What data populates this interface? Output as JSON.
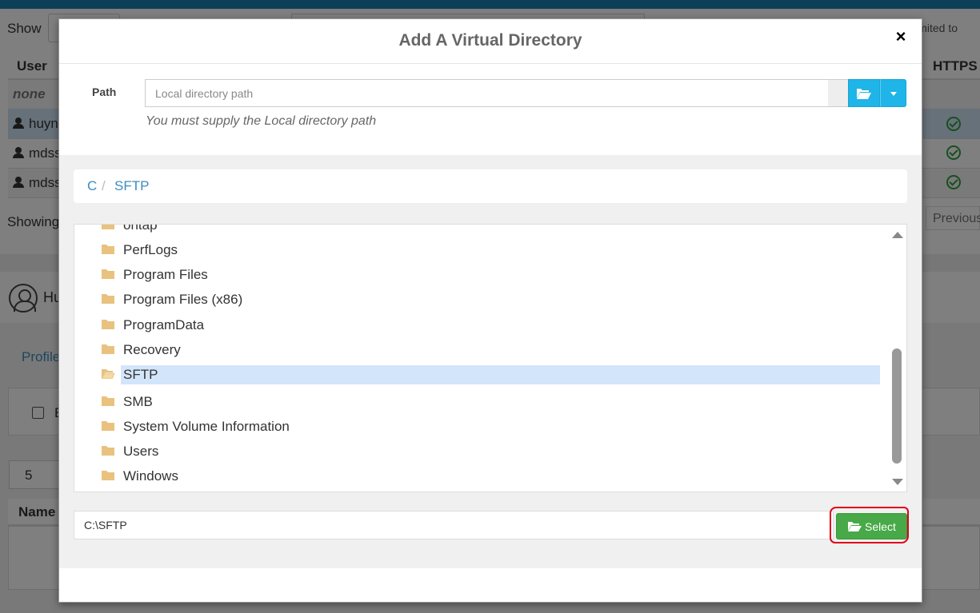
{
  "background": {
    "show_label": "Show",
    "filter_note": "er (limited to",
    "table": {
      "headers": {
        "user": "User",
        "https": "HTTPS"
      },
      "rows": [
        {
          "user": "none"
        },
        {
          "user": "huyn"
        },
        {
          "user": "mdss"
        },
        {
          "user": "mdss"
        }
      ]
    },
    "showing_text": "Showing",
    "previous_label": "Previous",
    "profile_heading": "Hu",
    "profile_tab": "Profile",
    "checkbox_label": "E",
    "page_size_value": "5",
    "name_header": "Name"
  },
  "modal": {
    "title": "Add A Virtual Directory",
    "close_glyph": "×",
    "path": {
      "label": "Path",
      "placeholder": "Local directory path",
      "value": "",
      "help_text": "You must supply the Local directory path"
    },
    "breadcrumb": [
      {
        "label": "C"
      },
      {
        "label": "SFTP"
      }
    ],
    "breadcrumb_separator": "/",
    "folders": [
      {
        "name": "ontap",
        "open": false,
        "selected": false
      },
      {
        "name": "PerfLogs",
        "open": false,
        "selected": false
      },
      {
        "name": "Program Files",
        "open": false,
        "selected": false
      },
      {
        "name": "Program Files (x86)",
        "open": false,
        "selected": false
      },
      {
        "name": "ProgramData",
        "open": false,
        "selected": false
      },
      {
        "name": "Recovery",
        "open": false,
        "selected": false
      },
      {
        "name": "SFTP",
        "open": true,
        "selected": true
      },
      {
        "name": "SMB",
        "open": false,
        "selected": false
      },
      {
        "name": "System Volume Information",
        "open": false,
        "selected": false
      },
      {
        "name": "Users",
        "open": false,
        "selected": false
      },
      {
        "name": "Windows",
        "open": false,
        "selected": false
      }
    ],
    "selected_path": "C:\\SFTP",
    "select_button_label": "Select",
    "icons": {
      "browse": "folder-open-icon",
      "dropdown": "caret-down-icon",
      "folder": "folder-icon",
      "folder_open": "folder-open-icon",
      "scroll_up": "scroll-up-arrow-icon",
      "scroll_down": "scroll-down-arrow-icon"
    }
  },
  "colors": {
    "browse_button": "#1fb5e8",
    "select_button": "#47a947",
    "folder": "#e8c27e",
    "selected_row": "#d3e5fa",
    "link": "#3c8dbc",
    "annotation": "#e0001a"
  }
}
